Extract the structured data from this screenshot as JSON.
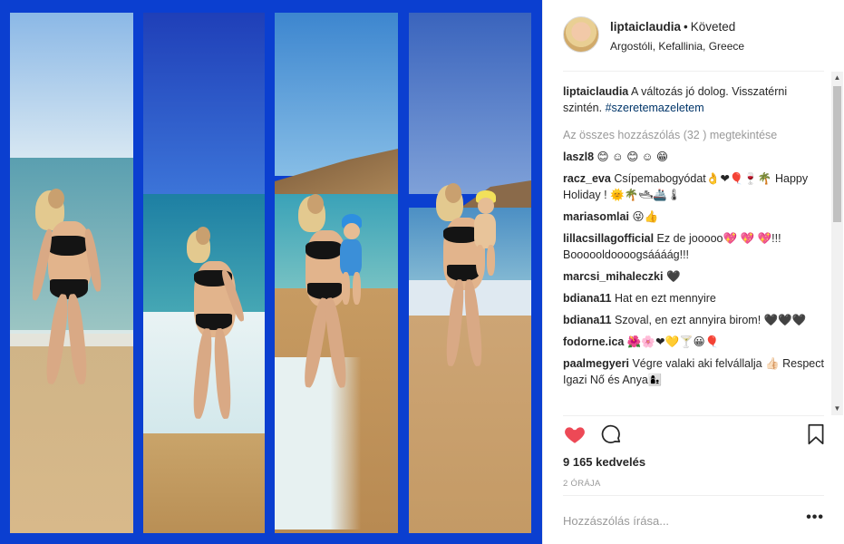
{
  "post": {
    "username": "liptaiclaudia",
    "separator": "•",
    "follow_label": "Követed",
    "location": "Argostóli, Kefallinia, Greece"
  },
  "caption": {
    "user": "liptaiclaudia",
    "text": "A változás jó dolog. Visszatérni szintén.",
    "hashtag": "#szeretemazeletem"
  },
  "view_all": "Az összes hozzászólás (32 ) megtekintése",
  "comments": [
    {
      "user": "laszl8",
      "text": "😊 ☺ 😊 ☺ 😁"
    },
    {
      "user": "racz_eva",
      "text": "Csípemabogyódat👌❤🎈🍷🌴 Happy Holiday ! 🌞🌴🛥🚢🌡"
    },
    {
      "user": "mariasomlai",
      "text": "😜👍"
    },
    {
      "user": "lillacsillagofficial",
      "text": "Ez de jooooo💖 💖 💖!!! Boooooldoooogsáááág!!!"
    },
    {
      "user": "marcsi_mihaleczki",
      "text": "🖤"
    },
    {
      "user": "bdiana11",
      "text": "Hat en ezt mennyire"
    },
    {
      "user": "bdiana11",
      "text": "Szoval, en ezt annyira birom! 🖤🖤🖤"
    },
    {
      "user": "fodorne.ica",
      "text": "🌺🌸❤💛🍸😀🎈"
    },
    {
      "user": "paalmegyeri",
      "text": "Végre valaki aki felvállalja 👍🏻 Respect Igazi Nő és Anya👩‍👦"
    }
  ],
  "likes": "9 165 kedvelés",
  "time": "2 ÓRÁJA",
  "add_comment_placeholder": "Hozzászólás írása...",
  "more_label": "•••",
  "scroll_up": "▲",
  "scroll_down": "▼",
  "icons": {
    "like": "heart-filled-icon",
    "comment": "comment-bubble-icon",
    "save": "bookmark-icon"
  },
  "colors": {
    "photo_border": "#0b3fd0",
    "like_red": "#ed4956",
    "hashtag": "#003569",
    "muted": "#999999"
  }
}
